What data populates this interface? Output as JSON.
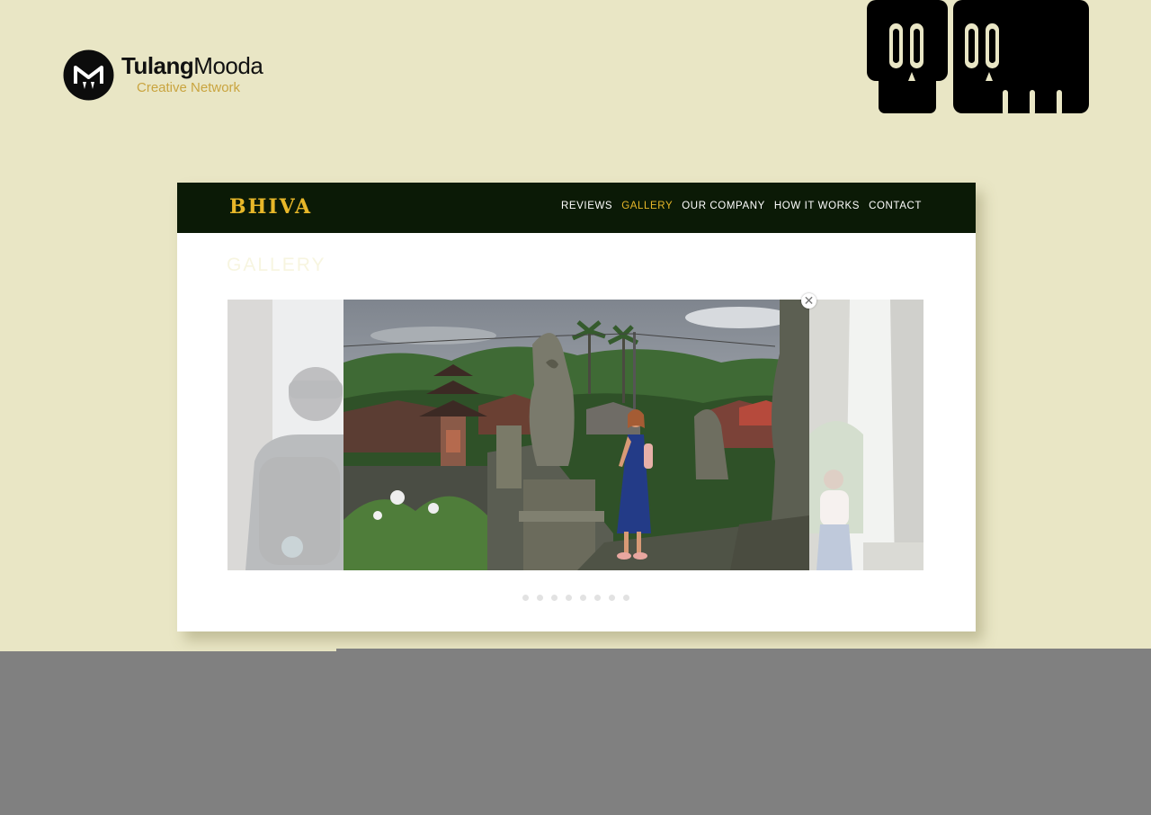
{
  "brand": {
    "name_bold": "Tulang",
    "name_light": "Mooda",
    "tagline": "Creative Network"
  },
  "site": {
    "logo": "BHIVA",
    "nav": [
      {
        "label": "REVIEWS",
        "active": false
      },
      {
        "label": "GALLERY",
        "active": true
      },
      {
        "label": "OUR COMPANY",
        "active": false
      },
      {
        "label": "HOW IT WORKS",
        "active": false
      },
      {
        "label": "CONTACT",
        "active": false
      }
    ],
    "section_title": "GALLERY",
    "gallery": {
      "close_symbol": "✕",
      "slides": [
        {
          "name": "hiker-backpack-photo",
          "state": "previous"
        },
        {
          "name": "bali-temple-woman-photo",
          "state": "active"
        },
        {
          "name": "temple-gate-traveler-photo",
          "state": "next"
        }
      ],
      "dot_count": 8
    }
  },
  "colors": {
    "page_bg": "#e9e6c5",
    "navbar_bg": "#0b1a06",
    "accent": "#e7b729",
    "tagline": "#c9a43f",
    "lower_band": "#808080"
  },
  "icons": {
    "brand_mark": "tulangmooda-logo-icon",
    "top_right": "skull-pair-icon",
    "close": "close-icon"
  }
}
